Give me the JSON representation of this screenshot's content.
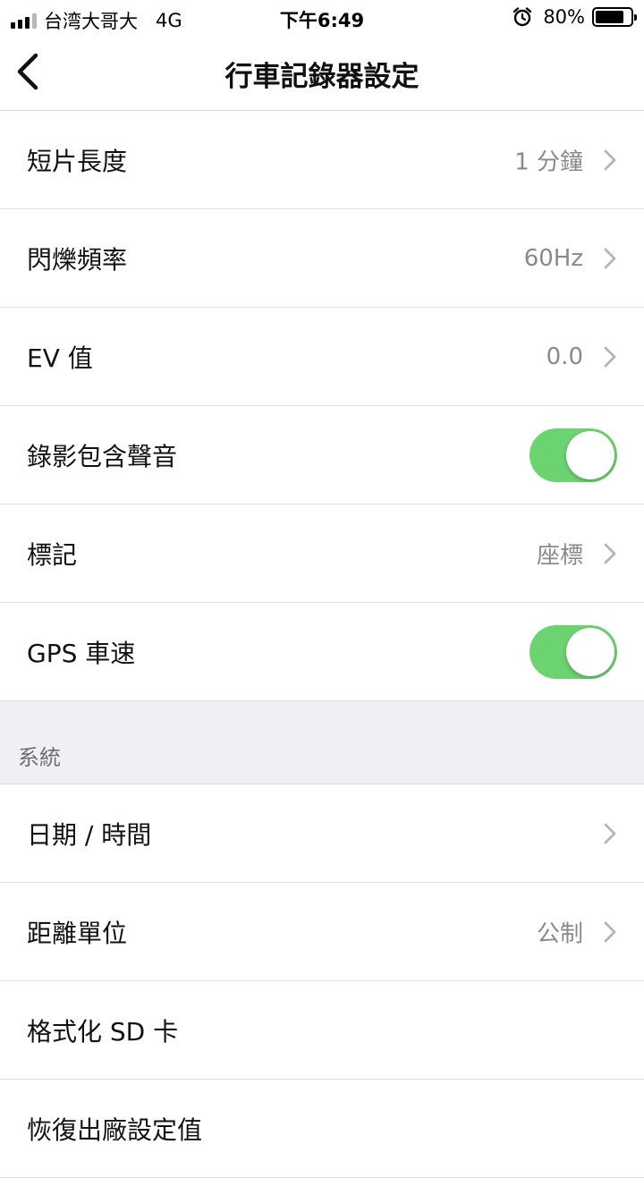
{
  "status_bar": {
    "carrier": "台湾大哥大",
    "network": "4G",
    "time": "下午6:49",
    "alarm_icon": "alarm-clock-icon",
    "battery_percent": "80%",
    "battery_level": 0.8
  },
  "nav": {
    "back_icon": "chevron-left-icon",
    "title": "行車記錄器設定"
  },
  "rows": [
    {
      "label": "短片長度",
      "value": "1 分鐘",
      "type": "disclosure"
    },
    {
      "label": "閃爍頻率",
      "value": "60Hz",
      "type": "disclosure"
    },
    {
      "label": "EV 值",
      "value": "0.0",
      "type": "disclosure"
    },
    {
      "label": "錄影包含聲音",
      "type": "toggle",
      "on": true
    },
    {
      "label": "標記",
      "value": "座標",
      "type": "disclosure"
    },
    {
      "label": "GPS 車速",
      "type": "toggle",
      "on": true
    }
  ],
  "system_section": {
    "header": "系統",
    "rows": [
      {
        "label": "日期 / 時間",
        "value": "",
        "type": "disclosure"
      },
      {
        "label": "距離單位",
        "value": "公制",
        "type": "disclosure"
      },
      {
        "label": "格式化 SD 卡",
        "type": "action"
      },
      {
        "label": "恢復出廠設定值",
        "type": "action"
      }
    ]
  },
  "colors": {
    "toggle_on": "#6bd36f",
    "section_bg": "#efeff4",
    "value_text": "#8a8a8a"
  }
}
